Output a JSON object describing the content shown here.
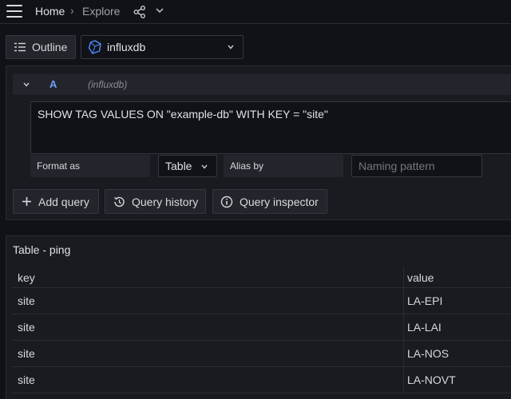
{
  "topbar": {
    "home": "Home",
    "separator": "›",
    "current": "Explore"
  },
  "toolbar": {
    "outline_label": "Outline",
    "datasource": "influxdb"
  },
  "query": {
    "letter": "A",
    "datasource_hint": "(influxdb)",
    "text": "SHOW TAG VALUES ON \"example-db\" WITH KEY = \"site\"",
    "format_label": "Format as",
    "format_value": "Table",
    "alias_label": "Alias by",
    "alias_placeholder": "Naming pattern"
  },
  "actions": {
    "add_query": "Add query",
    "query_history": "Query history",
    "query_inspector": "Query inspector"
  },
  "table": {
    "title": "Table - ping",
    "columns": [
      "key",
      "value"
    ],
    "rows": [
      [
        "site",
        "LA-EPI"
      ],
      [
        "site",
        "LA-LAI"
      ],
      [
        "site",
        "LA-NOS"
      ],
      [
        "site",
        "LA-NOVT"
      ]
    ]
  },
  "colors": {
    "background": "#111217",
    "panel": "#181b1f",
    "accent": "#6e9fff"
  }
}
